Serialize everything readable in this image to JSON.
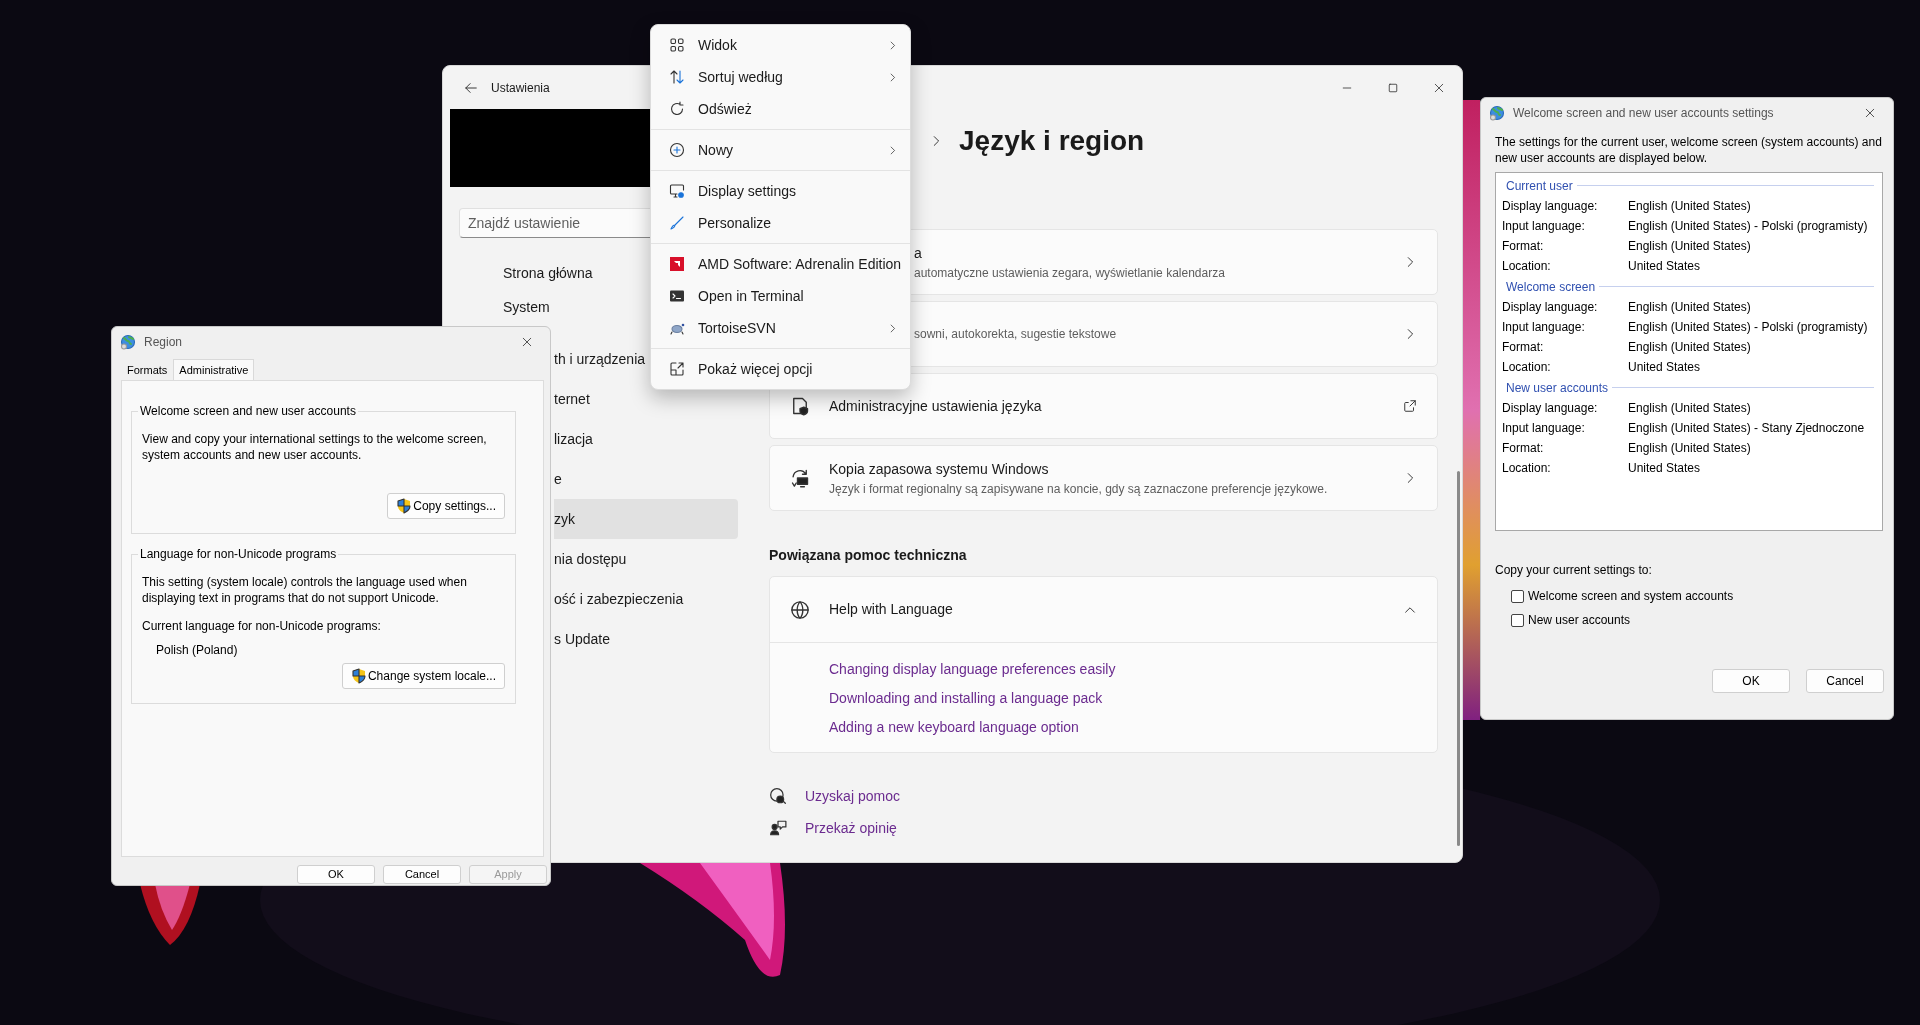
{
  "settings": {
    "title": "Ustawienia",
    "search": {
      "placeholder": "Znajdź ustawienie"
    },
    "nav": [
      {
        "label": "Strona główna",
        "kind": "full",
        "selected": false
      },
      {
        "label": "System",
        "kind": "full",
        "selected": false
      },
      {
        "label": "th i urządzenia",
        "kind": "clipped",
        "selected": false
      },
      {
        "label": "ternet",
        "kind": "clipped",
        "selected": false
      },
      {
        "label": "lizacja",
        "kind": "clipped",
        "selected": false
      },
      {
        "label": "e",
        "kind": "clipped",
        "selected": false
      },
      {
        "label": "zyk",
        "kind": "clipped",
        "selected": true
      },
      {
        "label": "nia dostępu",
        "kind": "clipped",
        "selected": false
      },
      {
        "label": "ość i zabezpieczenia",
        "kind": "clipped",
        "selected": false
      },
      {
        "label": "s Update",
        "kind": "clipped",
        "selected": false
      }
    ],
    "page_title": "Język i region",
    "cards": [
      {
        "kind": "clipped",
        "title": "a",
        "subtitle": "automatyczne ustawienia zegara, wyświetlanie kalendarza"
      },
      {
        "kind": "clipped",
        "subtitle": "sowni, autokorekta, sugestie tekstowe"
      },
      {
        "kind": "external",
        "title": "Administracyjne ustawienia języka"
      },
      {
        "kind": "page",
        "title": "Kopia zapasowa systemu Windows",
        "subtitle": "Język i format regionalny są zapisywane na koncie, gdy są zaznaczone preferencje językowe."
      }
    ],
    "related_heading": "Powiązana pomoc techniczna",
    "expander": {
      "title": "Help with Language",
      "expanded": true,
      "links": [
        "Changing display language preferences easily",
        "Downloading and installing a language pack",
        "Adding a new keyboard language option"
      ]
    },
    "footer_links": [
      "Uzyskaj pomoc",
      "Przekaż opinię"
    ]
  },
  "context_menu": {
    "groups": [
      [
        {
          "label": "Widok",
          "submenu": true
        },
        {
          "label": "Sortuj według",
          "submenu": true
        },
        {
          "label": "Odśwież",
          "submenu": false
        }
      ],
      [
        {
          "label": "Nowy",
          "submenu": true
        }
      ],
      [
        {
          "label": "Display settings",
          "submenu": false
        },
        {
          "label": "Personalize",
          "submenu": false
        }
      ],
      [
        {
          "label": "AMD Software: Adrenalin Edition",
          "submenu": false
        },
        {
          "label": "Open in Terminal",
          "submenu": false
        },
        {
          "label": "TortoiseSVN",
          "submenu": true
        }
      ],
      [
        {
          "label": "Pokaż więcej opcji",
          "submenu": false
        }
      ]
    ]
  },
  "region_dialog": {
    "title": "Region",
    "tabs": [
      {
        "label": "Formats",
        "selected": false
      },
      {
        "label": "Administrative",
        "selected": true
      }
    ],
    "groups": [
      {
        "legend": "Welcome screen and new user accounts",
        "texts": [
          "View and copy your international settings to the welcome screen, system accounts and new user accounts."
        ],
        "button": "Copy settings..."
      },
      {
        "legend": "Language for non-Unicode programs",
        "texts": [
          "This setting (system locale) controls the language used when displaying text in programs that do not support Unicode.",
          "Current language for non-Unicode programs:"
        ],
        "value": "Polish (Poland)",
        "button": "Change system locale..."
      }
    ],
    "buttons": [
      {
        "label": "OK",
        "disabled": false
      },
      {
        "label": "Cancel",
        "disabled": false
      },
      {
        "label": "Apply",
        "disabled": true
      }
    ]
  },
  "welcome_dialog": {
    "title": "Welcome screen and new user accounts settings",
    "intro": "The settings for the current user, welcome screen (system accounts) and new user accounts are displayed below.",
    "sections": [
      {
        "heading": "Current user",
        "rows": [
          {
            "label": "Display language:",
            "value": "English (United States)"
          },
          {
            "label": "Input language:",
            "value": "English (United States) - Polski (programisty)"
          },
          {
            "label": "Format:",
            "value": "English (United States)"
          },
          {
            "label": "Location:",
            "value": "United States"
          }
        ]
      },
      {
        "heading": "Welcome screen",
        "rows": [
          {
            "label": "Display language:",
            "value": "English (United States)"
          },
          {
            "label": "Input language:",
            "value": "English (United States) - Polski (programisty)"
          },
          {
            "label": "Format:",
            "value": "English (United States)"
          },
          {
            "label": "Location:",
            "value": "United States"
          }
        ]
      },
      {
        "heading": "New user accounts",
        "rows": [
          {
            "label": "Display language:",
            "value": "English (United States)"
          },
          {
            "label": "Input language:",
            "value": "English (United States) - Stany Zjednoczone"
          },
          {
            "label": "Format:",
            "value": "English (United States)"
          },
          {
            "label": "Location:",
            "value": "United States"
          }
        ]
      }
    ],
    "copy_label": "Copy your current settings to:",
    "checkboxes": [
      {
        "label": "Welcome screen and system accounts",
        "checked": false
      },
      {
        "label": "New user accounts",
        "checked": false
      }
    ],
    "buttons": [
      "OK",
      "Cancel"
    ]
  }
}
